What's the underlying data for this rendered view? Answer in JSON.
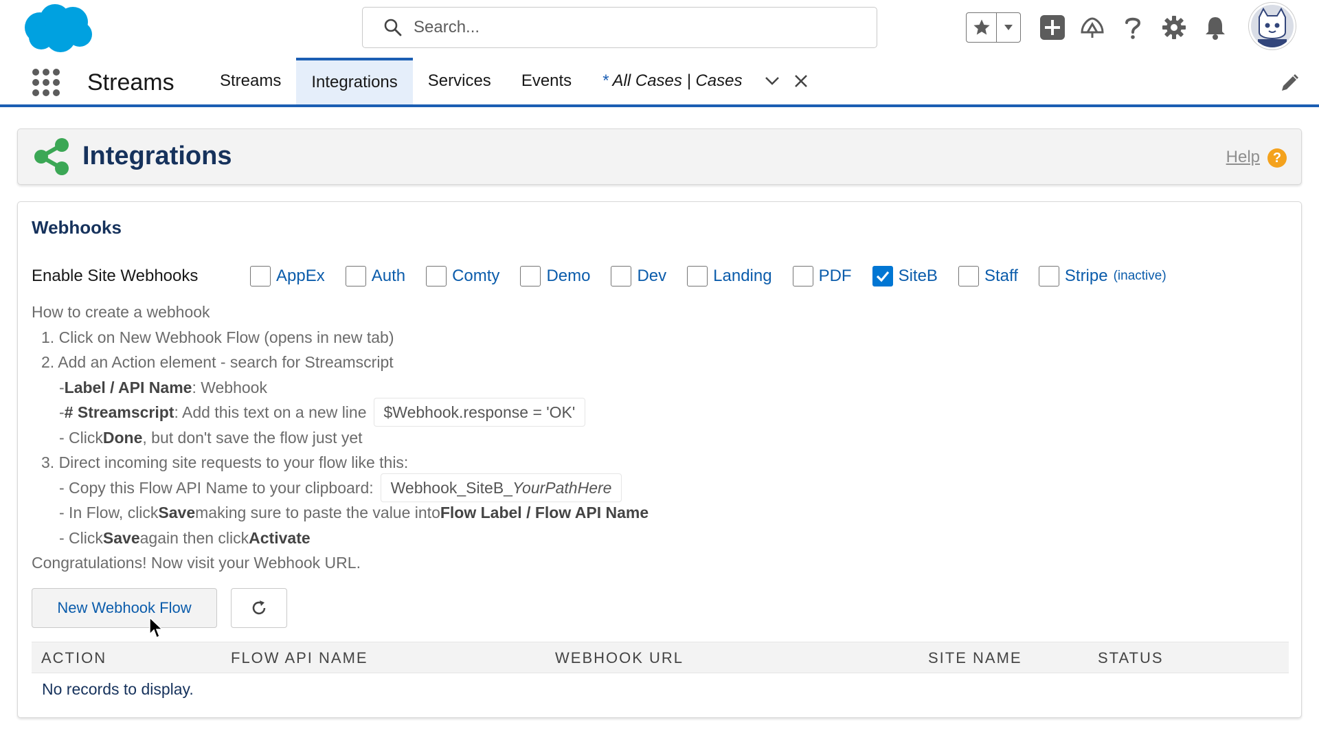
{
  "header": {
    "search_placeholder": "Search...",
    "icons": [
      "salesforce-cloud-logo",
      "search-icon",
      "star-icon",
      "chevron-down-icon",
      "plus-icon",
      "trailhead-icon",
      "question-icon",
      "gear-icon",
      "bell-icon",
      "avatar"
    ]
  },
  "nav": {
    "app_name": "Streams",
    "tabs": [
      {
        "label": "Streams"
      },
      {
        "label": "Integrations",
        "active": true
      },
      {
        "label": "Services"
      },
      {
        "label": "Events"
      }
    ],
    "workspace_tab": {
      "prefix": "*",
      "label": "All Cases | Cases"
    }
  },
  "page": {
    "title": "Integrations",
    "help_label": "Help",
    "help_icon_glyph": "?"
  },
  "webhooks": {
    "section_title": "Webhooks",
    "enable_label": "Enable Site Webhooks",
    "sites": [
      {
        "name": "AppEx",
        "checked": false
      },
      {
        "name": "Auth",
        "checked": false
      },
      {
        "name": "Comty",
        "checked": false
      },
      {
        "name": "Demo",
        "checked": false
      },
      {
        "name": "Dev",
        "checked": false
      },
      {
        "name": "Landing",
        "checked": false
      },
      {
        "name": "PDF",
        "checked": false
      },
      {
        "name": "SiteB",
        "checked": true
      },
      {
        "name": "Staff",
        "checked": false
      },
      {
        "name": "Stripe",
        "checked": false,
        "note": "(inactive)"
      }
    ],
    "instructions": {
      "heading": "How to create a webhook",
      "step1": "1. Click on New Webhook Flow (opens in new tab)",
      "step2": "2. Add an Action element - search for Streamscript",
      "step2a_prefix": "- ",
      "step2a_bold": "Label / API Name",
      "step2a_rest": ": Webhook",
      "step2b_prefix": "- ",
      "step2b_bold": "# Streamscript",
      "step2b_rest": ": Add this text on a new line",
      "step2b_code": "$Webhook.response = 'OK'",
      "step2c_prefix": "- Click ",
      "step2c_bold": "Done",
      "step2c_rest": ", but don't save the flow just yet",
      "step3": "3. Direct incoming site requests to your flow like this:",
      "step3a_text": "- Copy this Flow API Name to your clipboard:",
      "step3a_code_plain": "Webhook_SiteB_",
      "step3a_code_italic": "YourPathHere",
      "step3b_prefix": "- In Flow, click ",
      "step3b_bold1": "Save",
      "step3b_mid": " making sure to paste the value into ",
      "step3b_bold2": "Flow Label / Flow API Name",
      "step3c_prefix": "- Click ",
      "step3c_bold1": "Save",
      "step3c_mid": " again then click ",
      "step3c_bold2": "Activate",
      "congrats": "Congratulations! Now visit your Webhook URL."
    },
    "new_flow_button": "New Webhook Flow",
    "table": {
      "columns": [
        "Action",
        "Flow API Name",
        "Webhook URL",
        "Site Name",
        "Status"
      ],
      "empty_text": "No records to display."
    }
  },
  "colors": {
    "brand_blue": "#1b5eb3",
    "link_blue": "#0b5cab",
    "title_navy": "#16325c",
    "share_green": "#3ba755",
    "help_orange": "#f4a21d",
    "cloud_blue": "#00a1e0"
  }
}
